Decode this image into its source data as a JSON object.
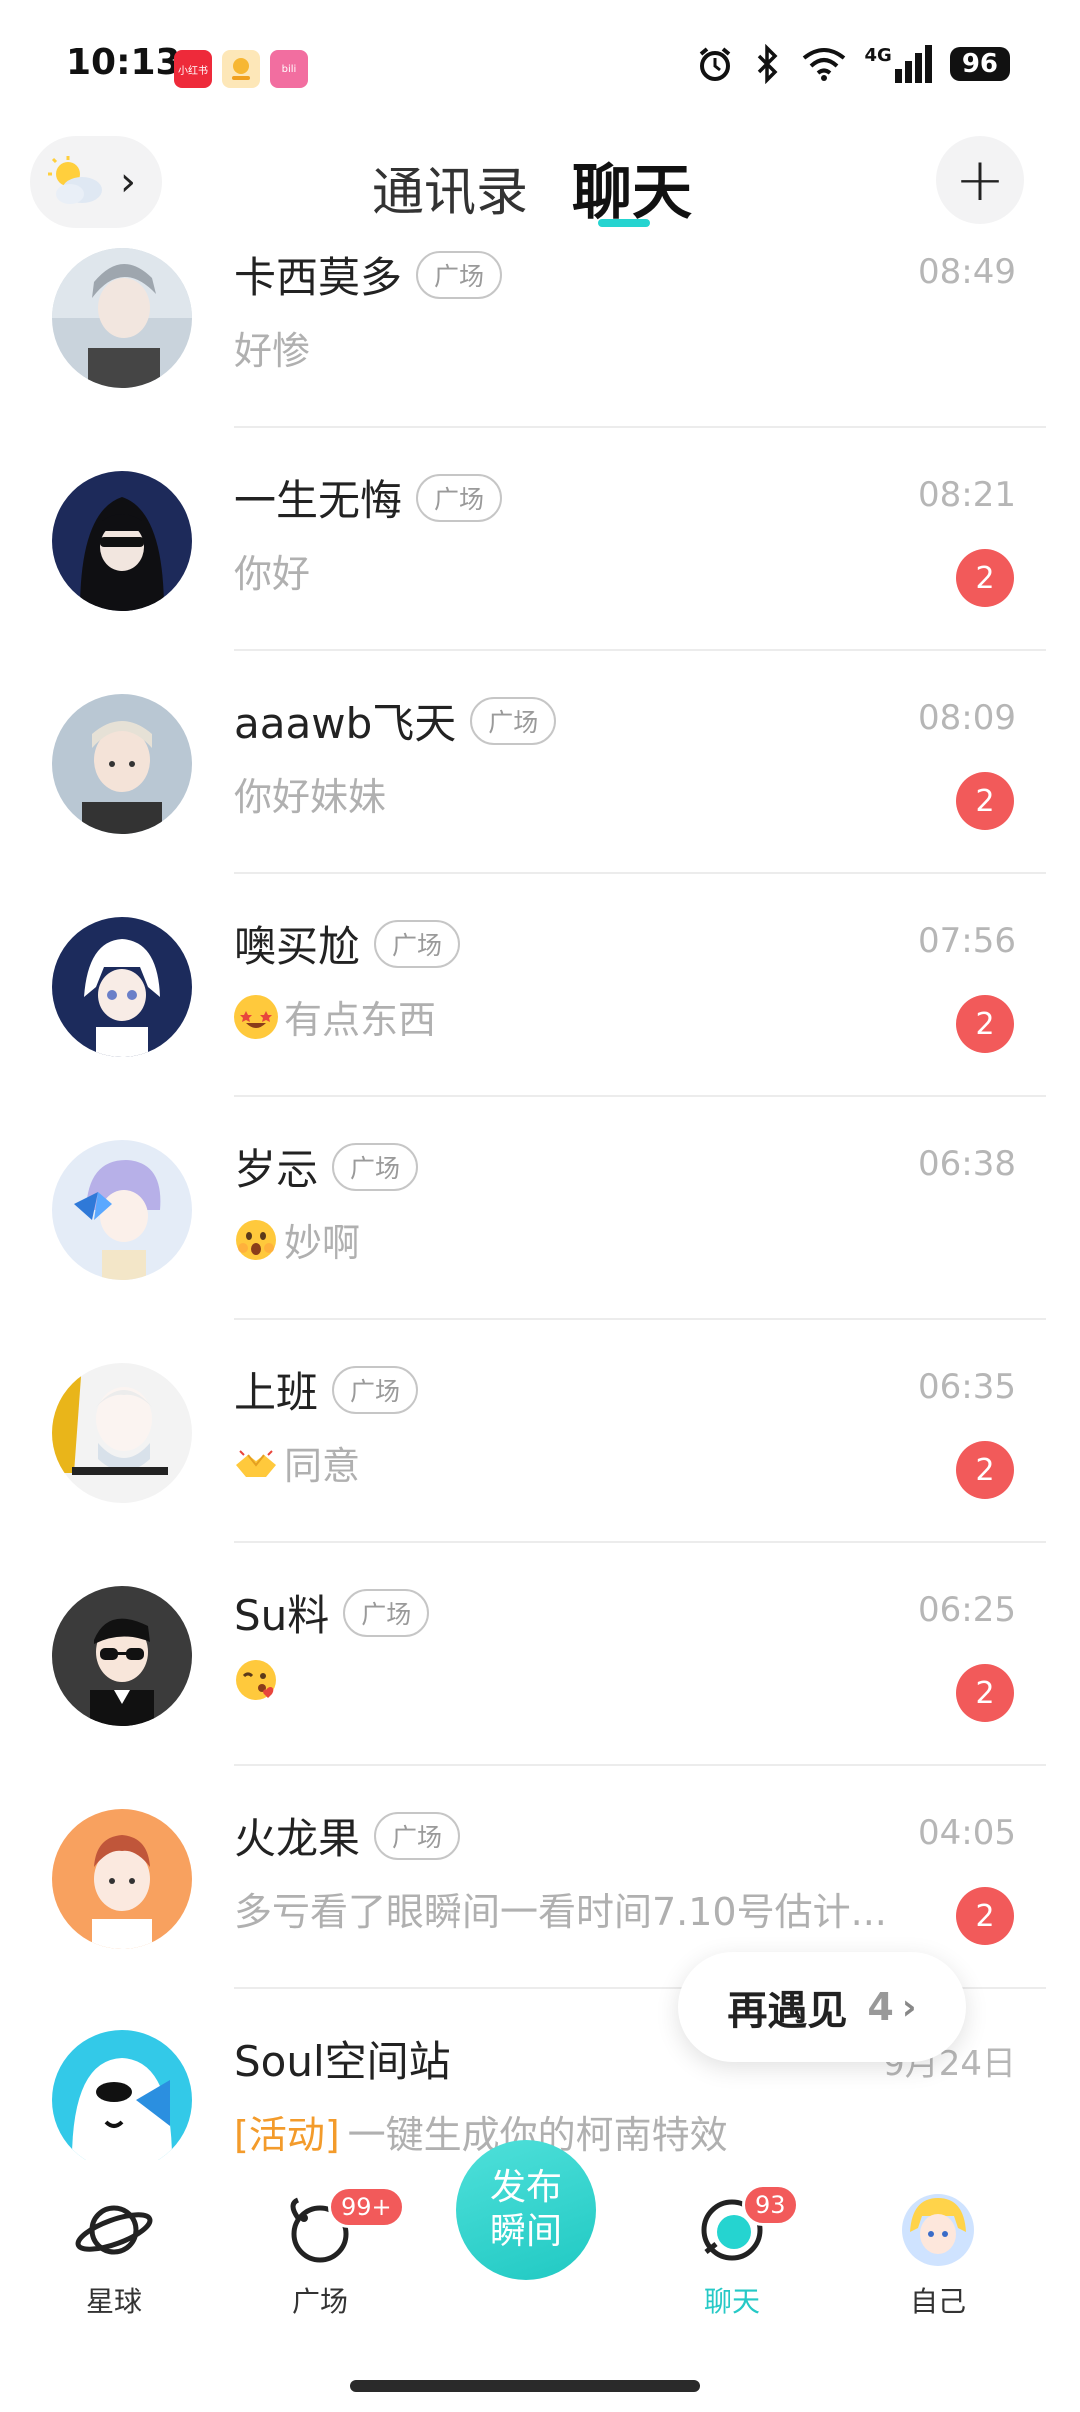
{
  "status_bar": {
    "time": "10:13",
    "apps": [
      {
        "name": "小红书",
        "color": "#ee2a3a"
      },
      {
        "name": "",
        "color": "#f7b733"
      },
      {
        "name": "bili",
        "color": "#f26ea0"
      }
    ],
    "network": "4G",
    "battery": "96"
  },
  "header": {
    "tabs": [
      "通讯录",
      "聊天"
    ],
    "active_tab": "聊天"
  },
  "chats": [
    {
      "name": "卡西莫多",
      "tag": "广场",
      "time": "08:49",
      "message": "好惨",
      "emoji": "",
      "badge": "",
      "avatar_color": "#c9d3dc"
    },
    {
      "name": "一生无悔",
      "tag": "广场",
      "time": "08:21",
      "message": "你好",
      "emoji": "",
      "badge": "2",
      "avatar_color": "#1d2a5a"
    },
    {
      "name": "aaawb飞天",
      "tag": "广场",
      "time": "08:09",
      "message": "你好妹妹",
      "emoji": "",
      "badge": "2",
      "avatar_color": "#b9c7d3"
    },
    {
      "name": "噢买尬",
      "tag": "广场",
      "time": "07:56",
      "message": "有点东西",
      "emoji": "star-struck",
      "badge": "2",
      "avatar_color": "#1c2b5c"
    },
    {
      "name": "岁忈",
      "tag": "广场",
      "time": "06:38",
      "message": "妙啊",
      "emoji": "astonished",
      "badge": "",
      "avatar_color": "#e4ecf7"
    },
    {
      "name": "上班",
      "tag": "广场",
      "time": "06:35",
      "message": "同意",
      "emoji": "handshake",
      "badge": "2",
      "avatar_color": "#f3f3f3"
    },
    {
      "name": "Su料",
      "tag": "广场",
      "time": "06:25",
      "message": "",
      "emoji": "kiss-wink",
      "badge": "2",
      "avatar_color": "#3b3b3b"
    },
    {
      "name": "火龙果",
      "tag": "广场",
      "time": "04:05",
      "message": "多亏看了眼瞬间一看时间7.10号估计...",
      "emoji": "",
      "badge": "2",
      "avatar_color": "#f8a15f"
    },
    {
      "name": "Soul空间站",
      "tag": "",
      "time": "9月24日",
      "message": "一键生成你的柯南特效",
      "prefix": "[活动]",
      "emoji": "",
      "badge": "",
      "avatar_color": "#33c9e8"
    }
  ],
  "float_pill": {
    "label": "再遇见",
    "count": "4"
  },
  "bottom_nav": {
    "items": [
      {
        "label": "星球",
        "badge": ""
      },
      {
        "label": "广场",
        "badge": "99+"
      },
      {
        "label": "聊天",
        "badge": "93"
      },
      {
        "label": "自己",
        "badge": ""
      }
    ],
    "publish_label_line1": "发布",
    "publish_label_line2": "瞬间"
  }
}
